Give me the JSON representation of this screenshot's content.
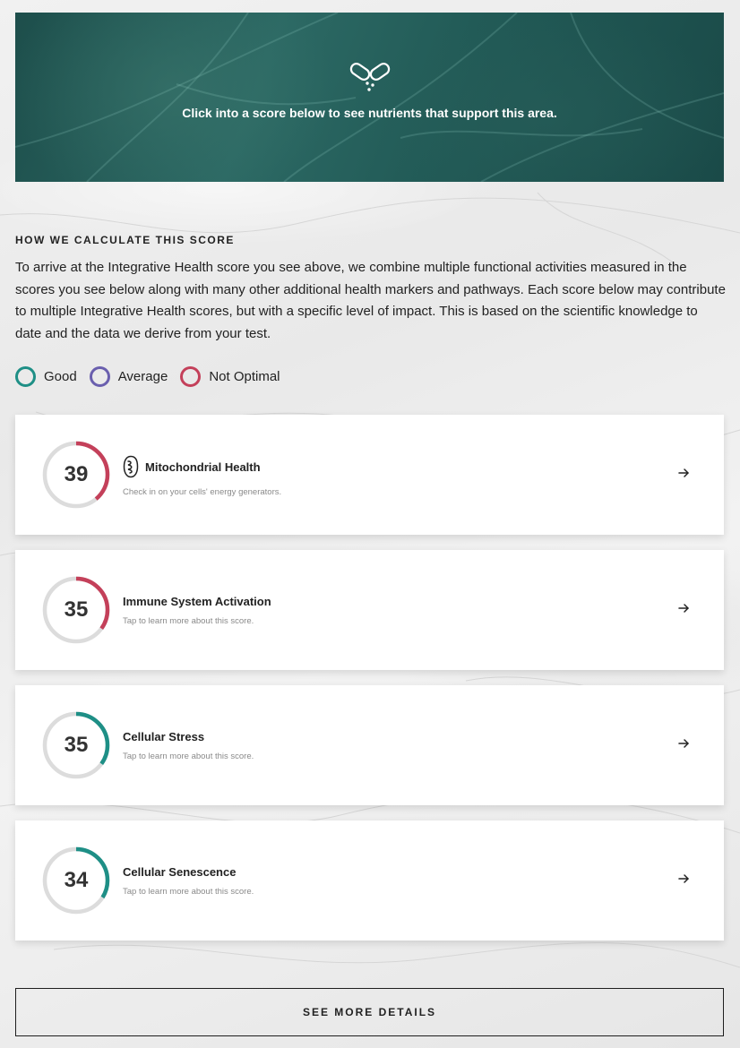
{
  "hero": {
    "message": "Click into a score below to see nutrients that support this area.",
    "icon": "capsules-icon"
  },
  "section": {
    "heading": "HOW WE CALCULATE THIS SCORE",
    "body": "To arrive at the Integrative Health score you see above, we combine multiple functional activities measured in the scores you see below along with many other additional health markers and pathways. Each score below may contribute to multiple Integrative Health scores, but with a specific level of impact. This is based on the scientific knowledge to date and the data we derive from your test."
  },
  "legend": [
    {
      "label": "Good",
      "color": "#1e8f86"
    },
    {
      "label": "Average",
      "color": "#6a5fae"
    },
    {
      "label": "Not Optimal",
      "color": "#c4405a"
    }
  ],
  "scores": [
    {
      "value": "39",
      "title": "Mitochondrial Health",
      "subtitle": "Check in on your cells' energy generators.",
      "status": "Not Optimal",
      "color": "#c4405a",
      "fraction": 0.39,
      "icon": "mitochondria-icon"
    },
    {
      "value": "35",
      "title": "Immune System Activation",
      "subtitle": "Tap to learn more about this score.",
      "status": "Not Optimal",
      "color": "#c4405a",
      "fraction": 0.35,
      "icon": ""
    },
    {
      "value": "35",
      "title": "Cellular Stress",
      "subtitle": "Tap to learn more about this score.",
      "status": "Good",
      "color": "#1e8f86",
      "fraction": 0.35,
      "icon": ""
    },
    {
      "value": "34",
      "title": "Cellular Senescence",
      "subtitle": "Tap to learn more about this score.",
      "status": "Good",
      "color": "#1e8f86",
      "fraction": 0.34,
      "icon": ""
    }
  ],
  "actions": {
    "details_label": "SEE MORE DETAILS"
  },
  "colors": {
    "track": "#dcdcdc",
    "hero_bg": "#225b57",
    "good": "#1e8f86",
    "average": "#6a5fae",
    "not_optimal": "#c4405a"
  }
}
